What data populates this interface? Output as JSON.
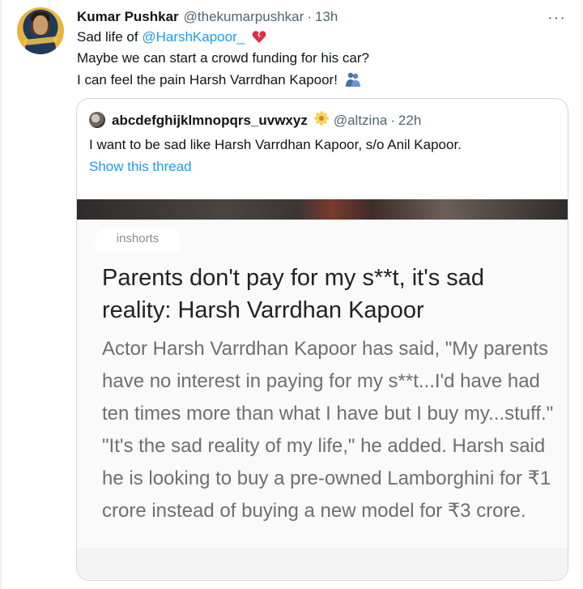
{
  "tweet": {
    "author_name": "Kumar Pushkar",
    "author_handle": "@thekumarpushkar",
    "separator": "·",
    "time": "13h",
    "more_icon": "more-horizontal-icon",
    "line1_prefix": "Sad life of ",
    "line1_mention": "@HarshKapoor_",
    "line1_emoji": "broken-heart-emoji",
    "line2": "Maybe we can start a crowd funding for his car?",
    "line3": "I can feel the pain Harsh Varrdhan Kapoor!",
    "line3_emoji": "people-hugging-emoji"
  },
  "quoted": {
    "author_name": "abcdefghijklmnopqrs_uvwxyz",
    "name_emoji": "sunflower-emoji",
    "author_handle": "@altzina",
    "separator": "·",
    "time": "22h",
    "text": "I want to be sad like Harsh Varrdhan Kapoor, s/o Anil Kapoor.",
    "thread_link": "Show this thread"
  },
  "media_card": {
    "source_tag": "inshorts",
    "headline": "Parents don't pay for my s**t, it's sad reality: Harsh Varrdhan Kapoor",
    "body": "Actor Harsh Varrdhan Kapoor has said, \"My parents have no interest in paying for my s**t...I'd have had ten times more than what I have but I buy my...stuff.\" \"It's the sad reality of my life,\" he added. Harsh said he is looking to buy a pre-owned Lamborghini for ₹1 crore instead of buying a new model for ₹3 crore."
  },
  "colors": {
    "link": "#1d9bf0",
    "secondary_text": "#536471",
    "border": "#cfd9de"
  }
}
